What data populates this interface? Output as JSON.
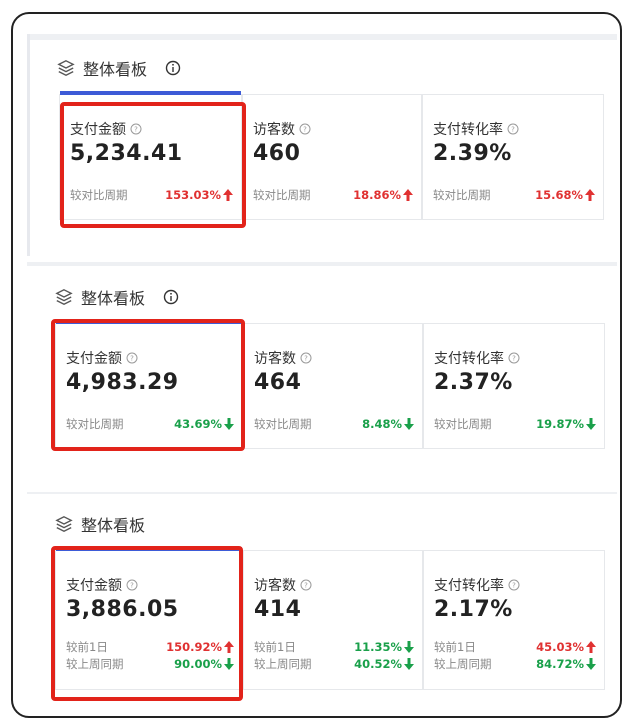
{
  "panels": [
    {
      "title": "整体看板",
      "show_info": true,
      "cards": [
        {
          "label": "支付金额",
          "value": "5,234.41",
          "rows": [
            {
              "text": "较对比周期",
              "pct": "153.03%",
              "dir": "up"
            }
          ]
        },
        {
          "label": "访客数",
          "value": "460",
          "rows": [
            {
              "text": "较对比周期",
              "pct": "18.86%",
              "dir": "up"
            }
          ]
        },
        {
          "label": "支付转化率",
          "value": "2.39%",
          "rows": [
            {
              "text": "较对比周期",
              "pct": "15.68%",
              "dir": "up"
            }
          ]
        }
      ]
    },
    {
      "title": "整体看板",
      "show_info": true,
      "cards": [
        {
          "label": "支付金额",
          "value": "4,983.29",
          "rows": [
            {
              "text": "较对比周期",
              "pct": "43.69%",
              "dir": "down"
            }
          ]
        },
        {
          "label": "访客数",
          "value": "464",
          "rows": [
            {
              "text": "较对比周期",
              "pct": "8.48%",
              "dir": "down"
            }
          ]
        },
        {
          "label": "支付转化率",
          "value": "2.37%",
          "rows": [
            {
              "text": "较对比周期",
              "pct": "19.87%",
              "dir": "down"
            }
          ]
        }
      ]
    },
    {
      "title": "整体看板",
      "show_info": false,
      "cards": [
        {
          "label": "支付金额",
          "value": "3,886.05",
          "rows": [
            {
              "text": "较前1日",
              "pct": "150.92%",
              "dir": "up"
            },
            {
              "text": "较上周同期",
              "pct": "90.00%",
              "dir": "down"
            }
          ]
        },
        {
          "label": "访客数",
          "value": "414",
          "rows": [
            {
              "text": "较前1日",
              "pct": "11.35%",
              "dir": "down"
            },
            {
              "text": "较上周同期",
              "pct": "40.52%",
              "dir": "down"
            }
          ]
        },
        {
          "label": "支付转化率",
          "value": "2.17%",
          "rows": [
            {
              "text": "较前1日",
              "pct": "45.03%",
              "dir": "up"
            },
            {
              "text": "较上周同期",
              "pct": "84.72%",
              "dir": "down"
            }
          ]
        }
      ]
    }
  ],
  "colors": {
    "up": "#e03131",
    "down": "#1aa04a",
    "accent": "#3d5bd7",
    "highlight": "#e2231a"
  }
}
